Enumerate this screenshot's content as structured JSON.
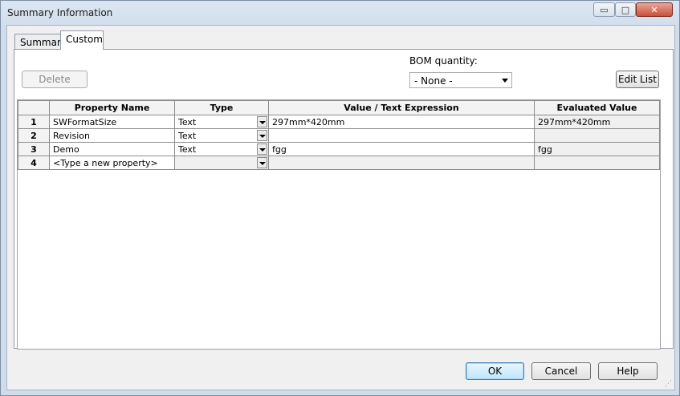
{
  "window": {
    "title": "Summary Information",
    "controls": {
      "minimize": "▭",
      "maximize": "□",
      "close": "✕"
    }
  },
  "tabs": [
    {
      "label": "Summary",
      "selected": false
    },
    {
      "label": "Custom",
      "selected": true
    }
  ],
  "toolbar": {
    "delete_label": "Delete",
    "bom_label": "BOM quantity:",
    "bom_value": "- None -",
    "edit_list_label": "Edit List"
  },
  "table": {
    "columns": [
      "",
      "Property Name",
      "Type",
      "Value / Text Expression",
      "Evaluated Value"
    ],
    "rows": [
      {
        "num": "1",
        "name": "SWFormatSize",
        "type": "Text",
        "value": "297mm*420mm",
        "evaluated": "297mm*420mm"
      },
      {
        "num": "2",
        "name": "Revision",
        "type": "Text",
        "value": "",
        "evaluated": ""
      },
      {
        "num": "3",
        "name": "Demo",
        "type": "Text",
        "value": "fgg",
        "evaluated": "fgg"
      },
      {
        "num": "4",
        "name": "<Type a new property>",
        "type": "",
        "value": "",
        "evaluated": ""
      }
    ]
  },
  "footer": {
    "ok_label": "OK",
    "cancel_label": "Cancel",
    "help_label": "Help"
  },
  "colors": {
    "default_button_border": "#3c7fb1",
    "grid_border": "#8c8c8c"
  }
}
